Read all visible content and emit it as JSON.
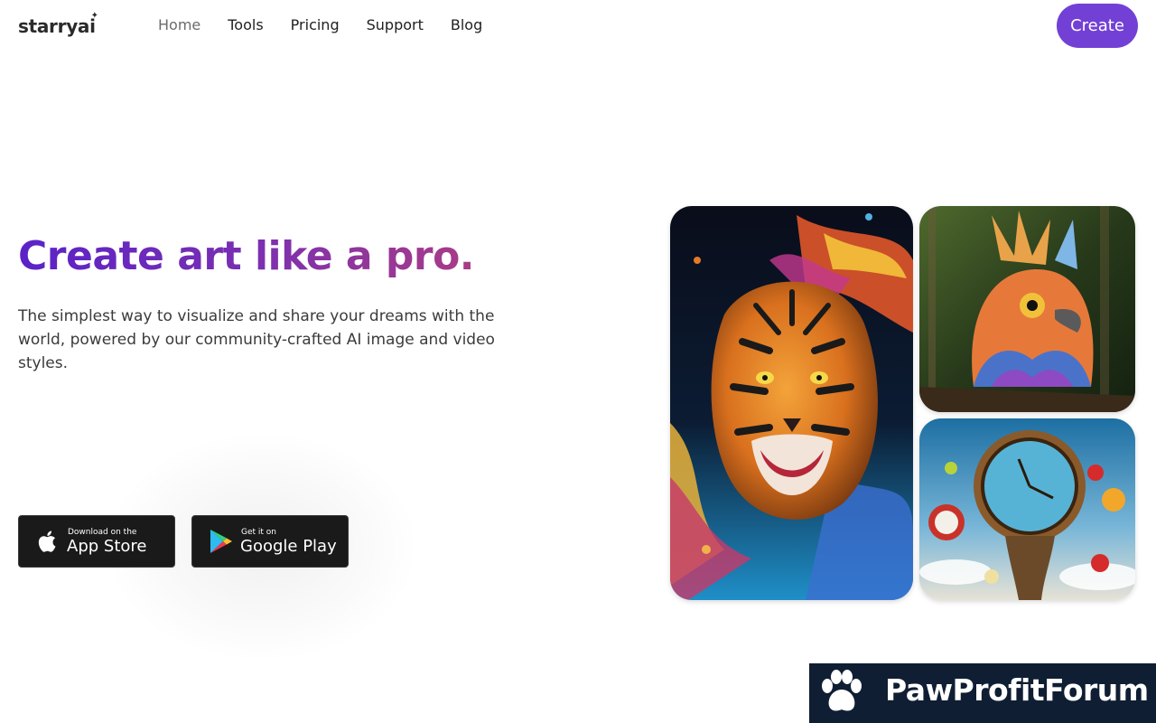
{
  "brand": {
    "logo_text": "starryai"
  },
  "nav": {
    "items": [
      {
        "label": "Home",
        "active": true
      },
      {
        "label": "Tools",
        "active": false
      },
      {
        "label": "Pricing",
        "active": false
      },
      {
        "label": "Support",
        "active": false
      },
      {
        "label": "Blog",
        "active": false
      }
    ]
  },
  "header": {
    "create_label": "Create"
  },
  "hero": {
    "title": "Create art like a pro.",
    "subtitle": "The simplest way to visualize and share your dreams with the world, powered by our community-crafted AI image and video styles."
  },
  "stores": {
    "appstore": {
      "small": "Download on the",
      "big": "App Store",
      "icon": "apple-icon"
    },
    "gplay": {
      "small": "Get it on",
      "big": "Google Play",
      "icon": "google-play-icon"
    }
  },
  "gallery": {
    "images": [
      {
        "subject": "tiger-artwork"
      },
      {
        "subject": "bird-artwork"
      },
      {
        "subject": "melting-clock-artwork"
      }
    ]
  },
  "watermark": {
    "text": "PawProfitForum",
    "icon": "paw-icon"
  },
  "colors": {
    "accent": "#7340d6",
    "title_gradient_start": "#5a22c8",
    "title_gradient_end": "#a93c86",
    "watermark_bg": "#0f1e33"
  }
}
